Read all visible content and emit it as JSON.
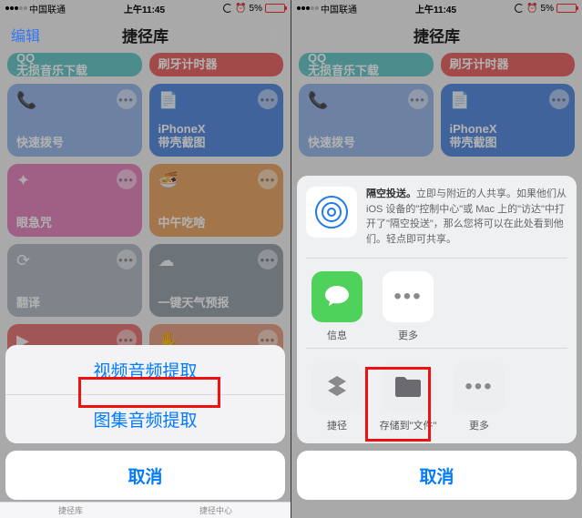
{
  "status": {
    "carrier": "中国联通",
    "time": "上午11:45",
    "battery_pct": "5%"
  },
  "nav": {
    "edit": "编辑",
    "title": "捷径库",
    "plus": "+"
  },
  "tiles": [
    {
      "line1": "QQ",
      "line2": "无损音乐下载",
      "c": "teal",
      "icon": ""
    },
    {
      "line1": "",
      "line2": "刷牙计时器",
      "c": "red",
      "icon": ""
    },
    {
      "line1": "",
      "line2": "快速拨号",
      "c": "bluelite",
      "icon": "📞"
    },
    {
      "line1": "",
      "line2": "iPhoneX\n带壳截图",
      "c": "blue",
      "icon": "📄"
    },
    {
      "line1": "",
      "line2": "眼急咒",
      "c": "pink",
      "icon": "✦"
    },
    {
      "line1": "",
      "line2": "中午吃啥",
      "c": "orange",
      "icon": "🍜"
    },
    {
      "line1": "",
      "line2": "翻译",
      "c": "gray",
      "icon": "⟳"
    },
    {
      "line1": "",
      "line2": "一键天气预报",
      "c": "graydark",
      "icon": "☁"
    },
    {
      "line1": "",
      "line2": "",
      "c": "rose",
      "icon": "▶"
    },
    {
      "line1": "",
      "line2": "",
      "c": "salmon",
      "icon": "✋"
    }
  ],
  "left_sheet": {
    "opt1": "视频音频提取",
    "opt2": "图集音频提取",
    "cancel": "取消"
  },
  "share": {
    "airdrop_title": "隔空投送。",
    "airdrop_body": "立即与附近的人共享。如果他们从 iOS 设备的\"控制中心\"或 Mac 上的\"访达\"中打开了\"隔空投送\"，那么您将可以在此处看到他们。轻点即可共享。",
    "row1": [
      {
        "label": "信息",
        "icon": "msg"
      },
      {
        "label": "更多",
        "icon": "more"
      }
    ],
    "row2": [
      {
        "label": "捷径",
        "icon": "sc"
      },
      {
        "label": "存储到\"文件\"",
        "icon": "folder"
      },
      {
        "label": "更多",
        "icon": "more"
      }
    ],
    "cancel": "取消"
  },
  "tabbar": {
    "a": "捷径库",
    "b": "捷径中心"
  }
}
